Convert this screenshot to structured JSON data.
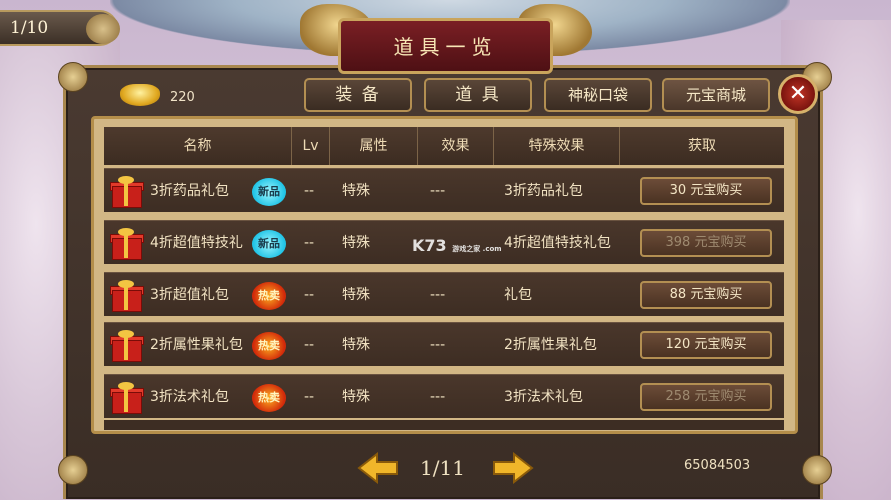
{
  "corner": {
    "page_counter": "1/10"
  },
  "title": "道具一览",
  "currency": {
    "amount": "220",
    "icon": "gold-ingot-icon"
  },
  "tabs": [
    {
      "label": "装 备"
    },
    {
      "label": "道 具"
    },
    {
      "label": "神秘口袋"
    },
    {
      "label": "元宝商城"
    }
  ],
  "close_label": "✕",
  "table": {
    "headers": [
      "名称",
      "Lv",
      "属性",
      "效果",
      "特殊效果",
      "获取"
    ],
    "rows": [
      {
        "name": "3折药品礼包",
        "badge": "新品",
        "lv": "--",
        "attr": "特殊",
        "effect": "---",
        "special": "3折药品礼包",
        "price_label": "30  元宝购买"
      },
      {
        "name": "4折超值特技礼",
        "badge": "新品",
        "lv": "--",
        "attr": "特殊",
        "effect": "---",
        "special": "4折超值特技礼包",
        "price_label": "398  元宝购买"
      },
      {
        "name": "3折超值礼包",
        "badge": "热卖",
        "lv": "--",
        "attr": "特殊",
        "effect": "---",
        "special": "礼包",
        "price_label": "88  元宝购买"
      },
      {
        "name": "2折属性果礼包",
        "badge": "热卖",
        "lv": "--",
        "attr": "特殊",
        "effect": "---",
        "special": "2折属性果礼包",
        "price_label": "120  元宝购买"
      },
      {
        "name": "3折法术礼包",
        "badge": "热卖",
        "lv": "--",
        "attr": "特殊",
        "effect": "---",
        "special": "3折法术礼包",
        "price_label": "258  元宝购买"
      }
    ]
  },
  "pagination": {
    "page": "1/11"
  },
  "account_id": "65084503",
  "watermark": {
    "main": "K73",
    "sub": "游戏之家 .com"
  },
  "colors": {
    "frame_gold": "#b38f52",
    "panel_bg": "#3d2d23",
    "title_red": "#7a1f24"
  }
}
